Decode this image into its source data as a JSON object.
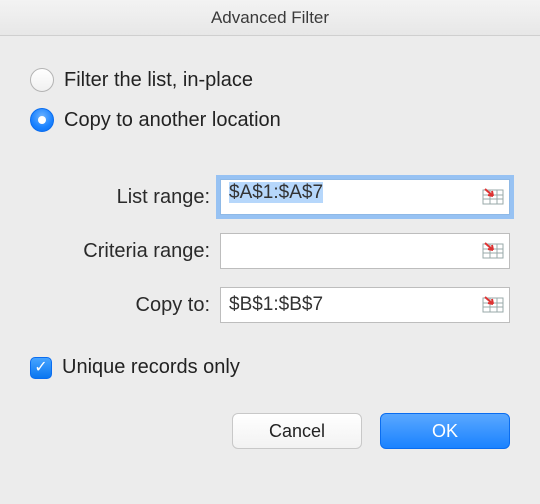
{
  "title": "Advanced Filter",
  "radios": {
    "inplace": {
      "label": "Filter the list, in-place",
      "selected": false
    },
    "copy": {
      "label": "Copy to another location",
      "selected": true
    }
  },
  "fields": {
    "list_range": {
      "label": "List range:",
      "value": "$A$1:$A$7",
      "focused": true
    },
    "criteria_range": {
      "label": "Criteria range:",
      "value": "",
      "focused": false
    },
    "copy_to": {
      "label": "Copy to:",
      "value": "$B$1:$B$7",
      "focused": false
    }
  },
  "unique": {
    "label": "Unique records only",
    "checked": true
  },
  "buttons": {
    "cancel": "Cancel",
    "ok": "OK"
  },
  "icons": {
    "range_ref": "range-selector-icon"
  }
}
